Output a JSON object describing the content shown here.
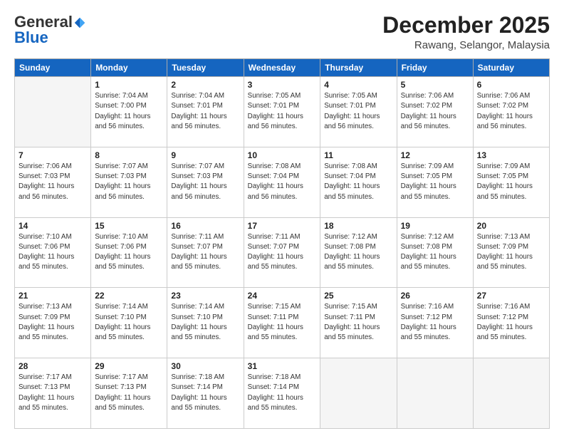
{
  "header": {
    "logo_general": "General",
    "logo_blue": "Blue",
    "month": "December 2025",
    "location": "Rawang, Selangor, Malaysia"
  },
  "days_of_week": [
    "Sunday",
    "Monday",
    "Tuesday",
    "Wednesday",
    "Thursday",
    "Friday",
    "Saturday"
  ],
  "weeks": [
    [
      {
        "day": "",
        "info": ""
      },
      {
        "day": "1",
        "info": "Sunrise: 7:04 AM\nSunset: 7:00 PM\nDaylight: 11 hours\nand 56 minutes."
      },
      {
        "day": "2",
        "info": "Sunrise: 7:04 AM\nSunset: 7:01 PM\nDaylight: 11 hours\nand 56 minutes."
      },
      {
        "day": "3",
        "info": "Sunrise: 7:05 AM\nSunset: 7:01 PM\nDaylight: 11 hours\nand 56 minutes."
      },
      {
        "day": "4",
        "info": "Sunrise: 7:05 AM\nSunset: 7:01 PM\nDaylight: 11 hours\nand 56 minutes."
      },
      {
        "day": "5",
        "info": "Sunrise: 7:06 AM\nSunset: 7:02 PM\nDaylight: 11 hours\nand 56 minutes."
      },
      {
        "day": "6",
        "info": "Sunrise: 7:06 AM\nSunset: 7:02 PM\nDaylight: 11 hours\nand 56 minutes."
      }
    ],
    [
      {
        "day": "7",
        "info": ""
      },
      {
        "day": "8",
        "info": "Sunrise: 7:07 AM\nSunset: 7:03 PM\nDaylight: 11 hours\nand 56 minutes."
      },
      {
        "day": "9",
        "info": "Sunrise: 7:07 AM\nSunset: 7:03 PM\nDaylight: 11 hours\nand 56 minutes."
      },
      {
        "day": "10",
        "info": "Sunrise: 7:08 AM\nSunset: 7:04 PM\nDaylight: 11 hours\nand 56 minutes."
      },
      {
        "day": "11",
        "info": "Sunrise: 7:08 AM\nSunset: 7:04 PM\nDaylight: 11 hours\nand 55 minutes."
      },
      {
        "day": "12",
        "info": "Sunrise: 7:09 AM\nSunset: 7:05 PM\nDaylight: 11 hours\nand 55 minutes."
      },
      {
        "day": "13",
        "info": "Sunrise: 7:09 AM\nSunset: 7:05 PM\nDaylight: 11 hours\nand 55 minutes."
      }
    ],
    [
      {
        "day": "14",
        "info": ""
      },
      {
        "day": "15",
        "info": "Sunrise: 7:10 AM\nSunset: 7:06 PM\nDaylight: 11 hours\nand 55 minutes."
      },
      {
        "day": "16",
        "info": "Sunrise: 7:11 AM\nSunset: 7:07 PM\nDaylight: 11 hours\nand 55 minutes."
      },
      {
        "day": "17",
        "info": "Sunrise: 7:11 AM\nSunset: 7:07 PM\nDaylight: 11 hours\nand 55 minutes."
      },
      {
        "day": "18",
        "info": "Sunrise: 7:12 AM\nSunset: 7:08 PM\nDaylight: 11 hours\nand 55 minutes."
      },
      {
        "day": "19",
        "info": "Sunrise: 7:12 AM\nSunset: 7:08 PM\nDaylight: 11 hours\nand 55 minutes."
      },
      {
        "day": "20",
        "info": "Sunrise: 7:13 AM\nSunset: 7:09 PM\nDaylight: 11 hours\nand 55 minutes."
      }
    ],
    [
      {
        "day": "21",
        "info": ""
      },
      {
        "day": "22",
        "info": "Sunrise: 7:14 AM\nSunset: 7:10 PM\nDaylight: 11 hours\nand 55 minutes."
      },
      {
        "day": "23",
        "info": "Sunrise: 7:14 AM\nSunset: 7:10 PM\nDaylight: 11 hours\nand 55 minutes."
      },
      {
        "day": "24",
        "info": "Sunrise: 7:15 AM\nSunset: 7:11 PM\nDaylight: 11 hours\nand 55 minutes."
      },
      {
        "day": "25",
        "info": "Sunrise: 7:15 AM\nSunset: 7:11 PM\nDaylight: 11 hours\nand 55 minutes."
      },
      {
        "day": "26",
        "info": "Sunrise: 7:16 AM\nSunset: 7:12 PM\nDaylight: 11 hours\nand 55 minutes."
      },
      {
        "day": "27",
        "info": "Sunrise: 7:16 AM\nSunset: 7:12 PM\nDaylight: 11 hours\nand 55 minutes."
      }
    ],
    [
      {
        "day": "28",
        "info": "Sunrise: 7:17 AM\nSunset: 7:13 PM\nDaylight: 11 hours\nand 55 minutes."
      },
      {
        "day": "29",
        "info": "Sunrise: 7:17 AM\nSunset: 7:13 PM\nDaylight: 11 hours\nand 55 minutes."
      },
      {
        "day": "30",
        "info": "Sunrise: 7:18 AM\nSunset: 7:14 PM\nDaylight: 11 hours\nand 55 minutes."
      },
      {
        "day": "31",
        "info": "Sunrise: 7:18 AM\nSunset: 7:14 PM\nDaylight: 11 hours\nand 55 minutes."
      },
      {
        "day": "",
        "info": ""
      },
      {
        "day": "",
        "info": ""
      },
      {
        "day": "",
        "info": ""
      }
    ]
  ],
  "week7_info": {
    "sunrise": "Sunrise: 7:06 AM",
    "sunset": "Sunset: 7:03 PM",
    "daylight": "Daylight: 11 hours",
    "minutes": "and 56 minutes."
  },
  "week14_info": {
    "sunrise": "Sunrise: 7:10 AM",
    "sunset": "Sunset: 7:06 PM",
    "daylight": "Daylight: 11 hours",
    "minutes": "and 55 minutes."
  },
  "week21_info": {
    "sunrise": "Sunrise: 7:13 AM",
    "sunset": "Sunset: 7:09 PM",
    "daylight": "Daylight: 11 hours",
    "minutes": "and 55 minutes."
  }
}
